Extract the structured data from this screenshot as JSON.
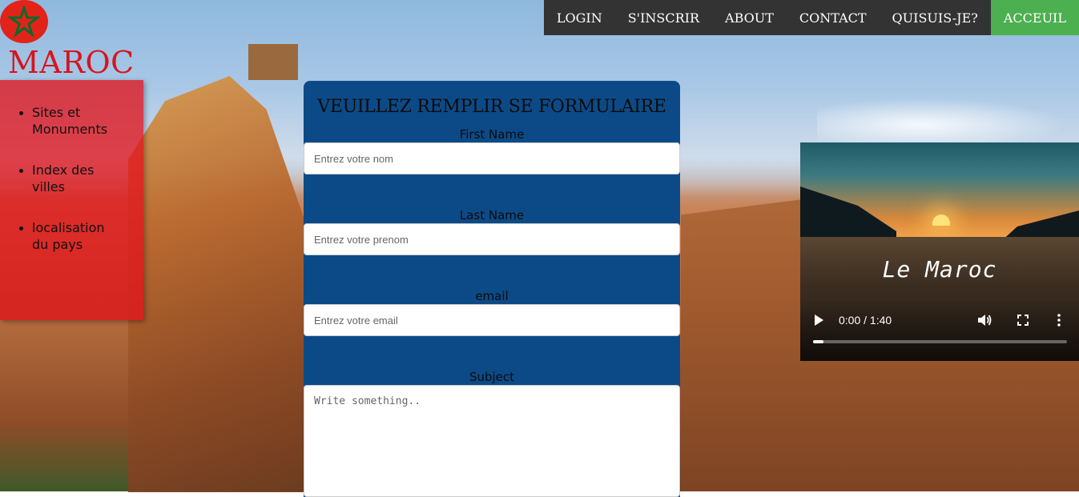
{
  "brand": {
    "name": "MAROC",
    "logo_icon": "morocco-flag-icon"
  },
  "nav": {
    "items": [
      {
        "label": "LOGIN",
        "active": false
      },
      {
        "label": "S'INSCRIR",
        "active": false
      },
      {
        "label": "ABOUT",
        "active": false
      },
      {
        "label": "CONTACT",
        "active": false
      },
      {
        "label": "QUISUIS-JE?",
        "active": false
      },
      {
        "label": "ACCEUIL",
        "active": true
      }
    ],
    "active_color": "#4caf50"
  },
  "sidemenu": {
    "items": [
      {
        "label": "Sites et Monuments"
      },
      {
        "label": "Index des villes"
      },
      {
        "label": "localisation du pays"
      }
    ]
  },
  "form": {
    "title": "VEUILLEZ REMPLIR SE FORMULAIRE",
    "first_name": {
      "label": "First Name",
      "placeholder": "Entrez votre nom",
      "value": ""
    },
    "last_name": {
      "label": "Last Name",
      "placeholder": "Entrez votre prenom",
      "value": ""
    },
    "email": {
      "label": "email",
      "placeholder": "Entrez votre email",
      "value": ""
    },
    "subject": {
      "label": "Subject",
      "placeholder": "Write something..",
      "value": ""
    }
  },
  "video": {
    "caption": "Le Maroc",
    "time": "0:00 / 1:40",
    "progress_fraction": 0.04
  },
  "colors": {
    "brand_red": "#d8141d",
    "form_bg": "#0c4a87",
    "nav_bg": "#333333"
  }
}
